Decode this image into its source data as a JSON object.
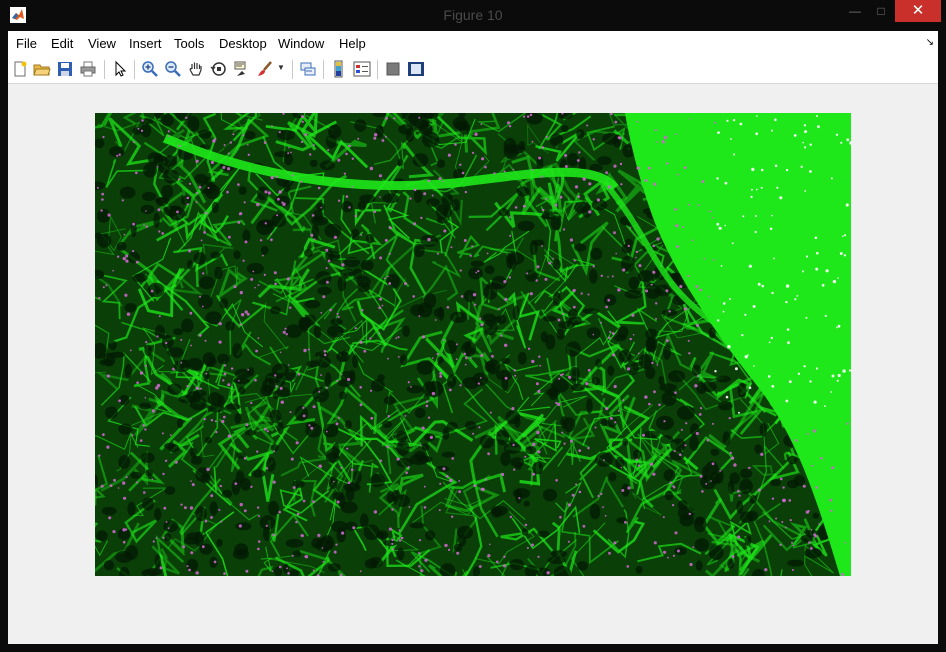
{
  "window": {
    "title": "Figure 10"
  },
  "menu": [
    "File",
    "Edit",
    "View",
    "Insert",
    "Tools",
    "Desktop",
    "Window",
    "Help"
  ],
  "toolbar": {
    "icons": [
      "new-figure-icon",
      "open-file-icon",
      "save-icon",
      "print-icon",
      "pointer-icon",
      "zoom-in-icon",
      "zoom-out-icon",
      "pan-hand-icon",
      "rotate-3d-icon",
      "data-cursor-icon",
      "brush-icon",
      "link-plot-icon",
      "colorbar-icon",
      "legend-icon",
      "hide-plot-tools-icon",
      "show-plot-tools-icon"
    ]
  },
  "figure": {
    "content": "fluorescence-microscopy-tissue",
    "colors": {
      "background": "#0a3f08",
      "signal": "#1ee81a",
      "nuclei": "#cc66cc"
    }
  }
}
